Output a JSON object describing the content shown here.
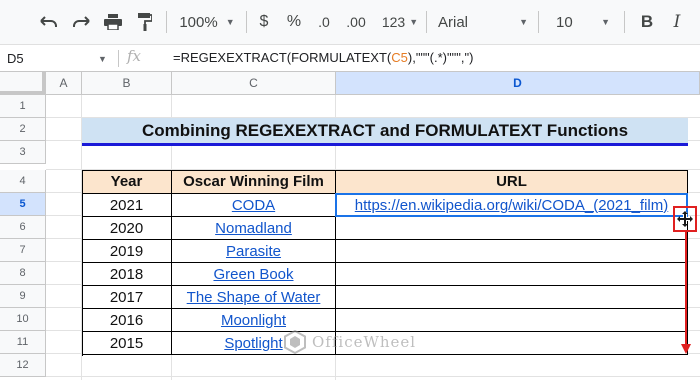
{
  "toolbar": {
    "zoom": "100%",
    "currency_symbol": "$",
    "percent_symbol": "%",
    "decrease_decimal": ".0",
    "increase_decimal": ".00",
    "more_formats": "123",
    "font_name": "Arial",
    "font_size": "10",
    "bold_label": "B",
    "italic_label": "I"
  },
  "formula_bar": {
    "name_box": "D5",
    "fx_label": "fx",
    "formula_prefix": "=REGEXEXTRACT(FORMULATEXT(",
    "formula_ref": "C5",
    "formula_suffix": "),\"\"\"(.*)\"\"\",\")"
  },
  "columns": [
    "A",
    "B",
    "C",
    "D"
  ],
  "selected_column": "D",
  "rows": [
    "1",
    "2",
    "3",
    "4",
    "5",
    "6",
    "7",
    "8",
    "9",
    "10",
    "11",
    "12"
  ],
  "selected_row": "5",
  "sheet": {
    "title": "Combining REGEXEXTRACT and FORMULATEXT Functions",
    "headers": [
      "Year",
      "Oscar Winning Film",
      "URL"
    ],
    "rows": [
      {
        "year": "2021",
        "film": "CODA",
        "url": "https://en.wikipedia.org/wiki/CODA_(2021_film)"
      },
      {
        "year": "2020",
        "film": "Nomadland",
        "url": ""
      },
      {
        "year": "2019",
        "film": "Parasite",
        "url": ""
      },
      {
        "year": "2018",
        "film": "Green Book",
        "url": ""
      },
      {
        "year": "2017",
        "film": "The Shape of Water",
        "url": ""
      },
      {
        "year": "2016",
        "film": "Moonlight",
        "url": ""
      },
      {
        "year": "2015",
        "film": "Spotlight",
        "url": ""
      }
    ]
  },
  "watermark": {
    "text": "OfficeWheel"
  },
  "colors": {
    "title_bg": "#cfe2f3",
    "title_underline": "#1a1ad8",
    "header_bg": "#fce5cd",
    "link": "#1155cc",
    "selection": "#1a73e8",
    "drag_highlight": "#e02020"
  }
}
